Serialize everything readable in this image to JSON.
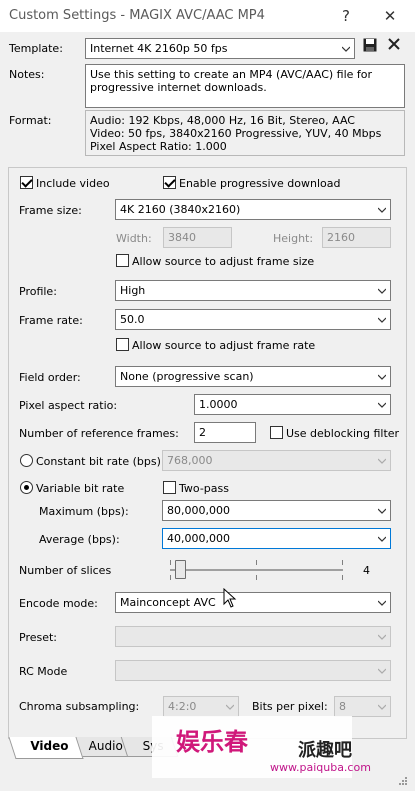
{
  "window": {
    "title": "Custom Settings - MAGIX AVC/AAC MP4",
    "help_label": "?",
    "close_label": "✕"
  },
  "header": {
    "template_label": "Template:",
    "template_value": "Internet 4K 2160p 50 fps",
    "notes_label": "Notes:",
    "notes_text": "Use this setting to create an MP4 (AVC/AAC) file for progressive internet downloads.",
    "format_label": "Format:",
    "format_lines": [
      "Audio: 192 Kbps, 48,000 Hz, 16 Bit, Stereo, AAC",
      "Video: 50 fps, 3840x2160 Progressive, YUV, 40 Mbps",
      "Pixel Aspect Ratio: 1.000"
    ]
  },
  "video": {
    "include_video_label": "Include video",
    "progressive_label": "Enable progressive download",
    "frame_size_label": "Frame size:",
    "frame_size_value": "4K 2160 (3840x2160)",
    "width_label": "Width:",
    "width_value": "3840",
    "height_label": "Height:",
    "height_value": "2160",
    "allow_frame_size_label": "Allow source to adjust frame size",
    "profile_label": "Profile:",
    "profile_value": "High",
    "frame_rate_label": "Frame rate:",
    "frame_rate_value": "50.0",
    "allow_frame_rate_label": "Allow source to adjust frame rate",
    "field_order_label": "Field order:",
    "field_order_value": "None (progressive scan)",
    "par_label": "Pixel aspect ratio:",
    "par_value": "1.0000",
    "ref_frames_label": "Number of reference frames:",
    "ref_frames_value": "2",
    "deblocking_label": "Use deblocking filter",
    "cbr_label": "Constant bit rate (bps):",
    "cbr_value": "768,000",
    "vbr_label": "Variable bit rate",
    "two_pass_label": "Two-pass",
    "max_label": "Maximum (bps):",
    "max_value": "80,000,000",
    "avg_label": "Average (bps):",
    "avg_value": "40,000,000",
    "slices_label": "Number of slices",
    "slices_value": "4",
    "slices_fraction": 0.0,
    "encode_mode_label": "Encode mode:",
    "encode_mode_value": "Mainconcept AVC",
    "preset_label": "Preset:",
    "rc_mode_label": "RC Mode",
    "chroma_label": "Chroma subsampling:",
    "chroma_value": "4:2:0",
    "bpp_label": "Bits per pixel:",
    "bpp_value": "8"
  },
  "tabs": [
    "Video",
    "Audio",
    "Sys"
  ],
  "watermark": {
    "brand_text": "娱乐春",
    "site_name": "派趣吧",
    "site_url": "www.paiquba.com"
  },
  "colors": {
    "focus": "#0078d7",
    "accent_brand": "#d0187a"
  }
}
